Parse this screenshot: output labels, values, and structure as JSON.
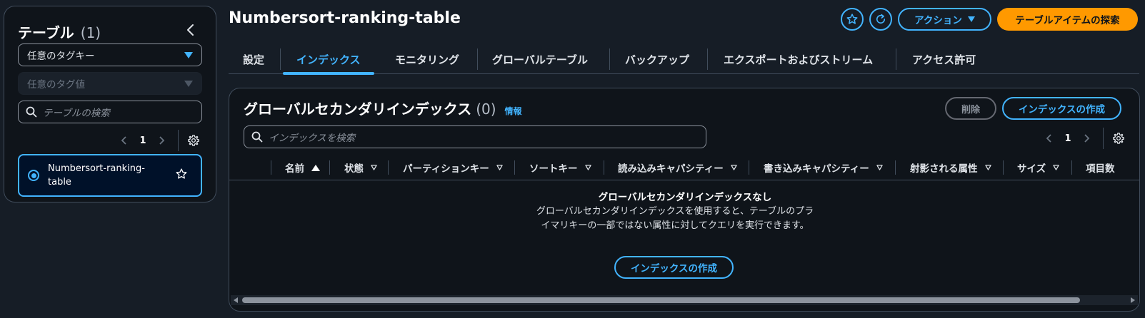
{
  "sidebar": {
    "title": "テーブル",
    "count": "(1)",
    "tag_key_placeholder": "任意のタグキー",
    "tag_value_placeholder": "任意のタグ値",
    "search_placeholder": "テーブルの検索",
    "page": "1",
    "tables": [
      {
        "name": "Numbersort-ranking-table",
        "selected": true
      }
    ]
  },
  "header": {
    "title": "Numbersort-ranking-table",
    "actions_label": "アクション",
    "explore_label": "テーブルアイテムの探索"
  },
  "tabs": [
    {
      "label": "設定",
      "active": false
    },
    {
      "label": "インデックス",
      "active": true
    },
    {
      "label": "モニタリング",
      "active": false
    },
    {
      "label": "グローバルテーブル",
      "active": false
    },
    {
      "label": "バックアップ",
      "active": false
    },
    {
      "label": "エクスポートおよびストリーム",
      "active": false
    },
    {
      "label": "アクセス許可",
      "active": false
    }
  ],
  "panel": {
    "title": "グローバルセカンダリインデックス",
    "count": "(0)",
    "info": "情報",
    "delete_label": "削除",
    "create_label": "インデックスの作成",
    "search_placeholder": "インデックスを検索",
    "page": "1",
    "columns": [
      "名前",
      "状態",
      "パーティションキー",
      "ソートキー",
      "読み込みキャパシティー",
      "書き込みキャパシティー",
      "射影される属性",
      "サイズ",
      "項目数"
    ],
    "empty_title": "グローバルセカンダリインデックスなし",
    "empty_desc": "グローバルセカンダリインデックスを使用すると、テーブルのプライマリキーの一部ではない属性に対してクエリを実行できます。",
    "empty_create_label": "インデックスの作成"
  },
  "colors": {
    "accent": "#42b4ff",
    "primary_button": "#ff9900",
    "background": "#161d26"
  }
}
